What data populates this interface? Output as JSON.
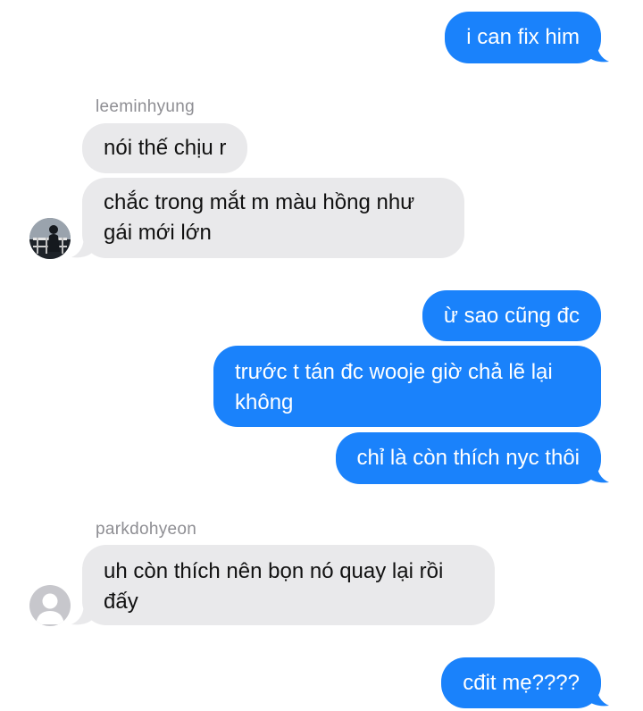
{
  "conversation": {
    "messages": [
      {
        "text": "i can fix him"
      },
      {
        "text": "nói thế chịu r"
      },
      {
        "text": "chắc trong mắt m màu hồng như gái mới lớn"
      },
      {
        "text": "ừ sao cũng đc"
      },
      {
        "text": "trước t tán đc wooje giờ chả lẽ lại không"
      },
      {
        "text": "chỉ là còn thích nyc thôi"
      },
      {
        "text": "uh còn thích nên bọn nó quay lại rồi đấy"
      },
      {
        "text": "cđit mẹ????"
      }
    ],
    "senders": {
      "first": "leeminhyung",
      "second": "parkdohyeon"
    }
  },
  "colors": {
    "outgoing_bubble": "#1a82fb",
    "incoming_bubble": "#e9e9eb",
    "sender_name": "#8e8e93"
  },
  "icons": {
    "first_avatar": "photo-avatar",
    "second_avatar": "default-person-avatar"
  }
}
